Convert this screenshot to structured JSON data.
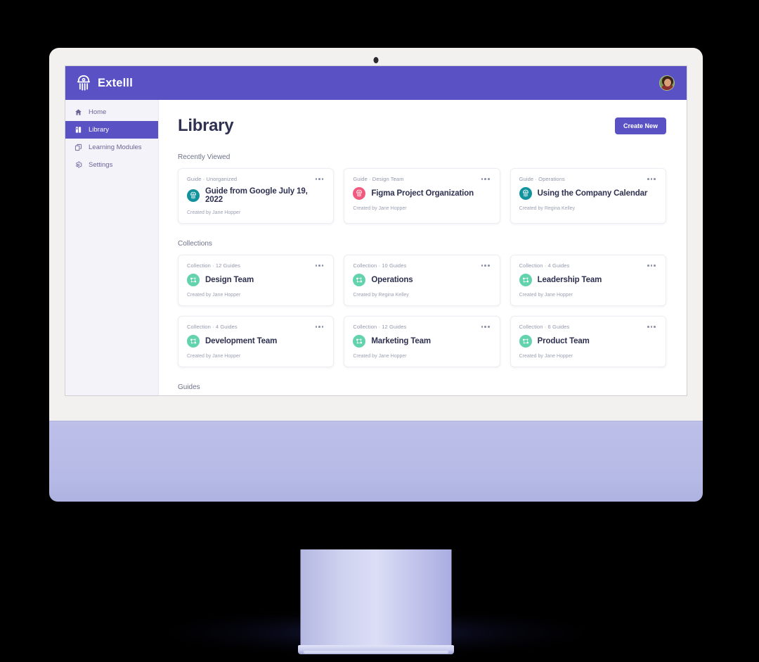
{
  "device": {
    "type": "desktop-monitor",
    "camera_icon": "camera-dot",
    "bezel_color": "#f2f1ef",
    "chin_color": "#b8bce6",
    "background_color": "#000000"
  },
  "app": {
    "brand_name": "Extelll",
    "brand_logo_icon": "jellyfish-logo-icon",
    "accent_color": "#5a52c4",
    "avatar_icon": "user-avatar"
  },
  "sidebar": {
    "items": [
      {
        "label": "Home",
        "icon": "home-icon",
        "active": false
      },
      {
        "label": "Library",
        "icon": "book-icon",
        "active": true
      },
      {
        "label": "Learning Modules",
        "icon": "modules-icon",
        "active": false
      },
      {
        "label": "Settings",
        "icon": "gear-icon",
        "active": false
      }
    ]
  },
  "main": {
    "page_title": "Library",
    "create_button_label": "Create New",
    "sections": [
      {
        "label": "Recently Viewed"
      },
      {
        "label": "Collections"
      },
      {
        "label": "Guides"
      }
    ]
  },
  "recently_viewed": [
    {
      "type": "Guide",
      "category": "Unorganized",
      "meta": "Guide  ·  Unorganized",
      "title": "Guide from Google July 19, 2022",
      "creator": "Created by Jane Hopper",
      "icon": "jellyfish-badge-icon",
      "icon_color": "#12929c"
    },
    {
      "type": "Guide",
      "category": "Design Team",
      "meta": "Guide  ·  Design Team",
      "title": "Figma Project Organization",
      "creator": "Created by Jane Hopper",
      "icon": "jellyfish-badge-icon",
      "icon_color": "#ef5a7e"
    },
    {
      "type": "Guide",
      "category": "Operations",
      "meta": "Guide  ·  Operations",
      "title": "Using the Company Calendar",
      "creator": "Created by Regina Kelley",
      "icon": "jellyfish-badge-icon",
      "icon_color": "#12929c"
    }
  ],
  "collections": [
    {
      "type": "Collection",
      "count": "12 Guides",
      "meta": "Collection  ·  12 Guides",
      "title": "Design Team",
      "creator": "Created by Jane Hopper",
      "icon": "collection-badge-icon",
      "icon_color": "#63d3ad"
    },
    {
      "type": "Collection",
      "count": "10 Guides",
      "meta": "Collection  ·  10 Guides",
      "title": "Operations",
      "creator": "Created by Regina Kelley",
      "icon": "collection-badge-icon",
      "icon_color": "#63d3ad"
    },
    {
      "type": "Collection",
      "count": "4 Guides",
      "meta": "Collection  ·  4 Guides",
      "title": "Leadership Team",
      "creator": "Created by Jane Hopper",
      "icon": "collection-badge-icon",
      "icon_color": "#63d3ad"
    },
    {
      "type": "Collection",
      "count": "4 Guides",
      "meta": "Collection  ·  4 Guides",
      "title": "Development Team",
      "creator": "Created by Jane Hopper",
      "icon": "collection-badge-icon",
      "icon_color": "#63d3ad"
    },
    {
      "type": "Collection",
      "count": "12 Guides",
      "meta": "Collection  ·  12 Guides",
      "title": "Marketing Team",
      "creator": "Created by Jane Hopper",
      "icon": "collection-badge-icon",
      "icon_color": "#63d3ad"
    },
    {
      "type": "Collection",
      "count": "6 Guides",
      "meta": "Collection  ·  6 Guides",
      "title": "Product Team",
      "creator": "Created by Jane Hopper",
      "icon": "collection-badge-icon",
      "icon_color": "#63d3ad"
    }
  ]
}
